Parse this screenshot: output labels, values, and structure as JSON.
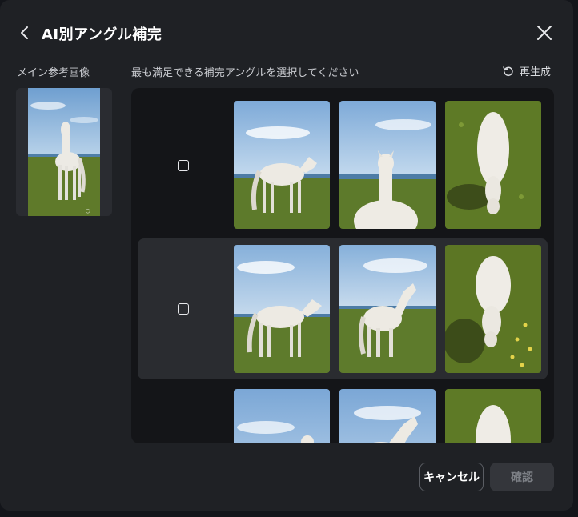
{
  "dialog": {
    "title": "AI別アングル補完",
    "reference_label": "メイン参考画像",
    "instruction": "最も満足できる補完アングルを選択してください",
    "regenerate_label": "再生成",
    "cancel_label": "キャンセル",
    "confirm_label": "確認"
  },
  "rows": [
    {
      "checked": false,
      "selected": false,
      "thumbs": [
        {
          "view": "side-profile-right"
        },
        {
          "view": "back-view"
        },
        {
          "view": "top-down"
        }
      ]
    },
    {
      "checked": false,
      "selected": true,
      "thumbs": [
        {
          "view": "side-profile-right"
        },
        {
          "view": "rear-three-quarter"
        },
        {
          "view": "top-down"
        }
      ]
    },
    {
      "checked": false,
      "selected": false,
      "thumbs": [
        {
          "view": "side-partial"
        },
        {
          "view": "rear-three-quarter-partial"
        },
        {
          "view": "top-down-partial"
        }
      ]
    }
  ],
  "icons": {
    "back": "chevron-left-icon",
    "close": "close-icon",
    "regenerate": "refresh-icon"
  },
  "colors": {
    "dialog_bg": "#1f2125",
    "panel_bg": "#141518",
    "selected_row_bg": "#2a2c30",
    "sky": "#8fb4d8",
    "grass": "#5f7a2a"
  }
}
